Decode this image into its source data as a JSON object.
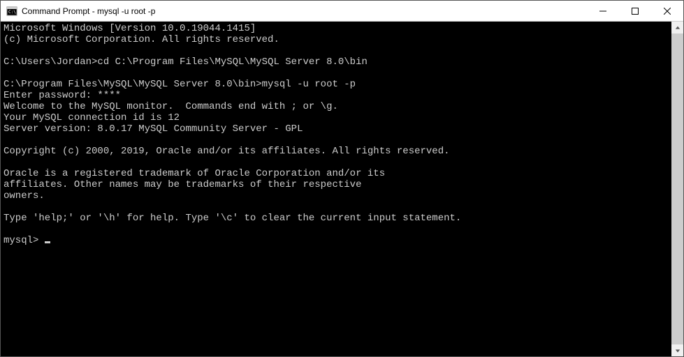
{
  "titlebar": {
    "title": "Command Prompt - mysql  -u root -p"
  },
  "terminal": {
    "lines": [
      "Microsoft Windows [Version 10.0.19044.1415]",
      "(c) Microsoft Corporation. All rights reserved.",
      "",
      "C:\\Users\\Jordan>cd C:\\Program Files\\MySQL\\MySQL Server 8.0\\bin",
      "",
      "C:\\Program Files\\MySQL\\MySQL Server 8.0\\bin>mysql -u root -p",
      "Enter password: ****",
      "Welcome to the MySQL monitor.  Commands end with ; or \\g.",
      "Your MySQL connection id is 12",
      "Server version: 8.0.17 MySQL Community Server - GPL",
      "",
      "Copyright (c) 2000, 2019, Oracle and/or its affiliates. All rights reserved.",
      "",
      "Oracle is a registered trademark of Oracle Corporation and/or its",
      "affiliates. Other names may be trademarks of their respective",
      "owners.",
      "",
      "Type 'help;' or '\\h' for help. Type '\\c' to clear the current input statement.",
      ""
    ],
    "prompt": "mysql> "
  }
}
